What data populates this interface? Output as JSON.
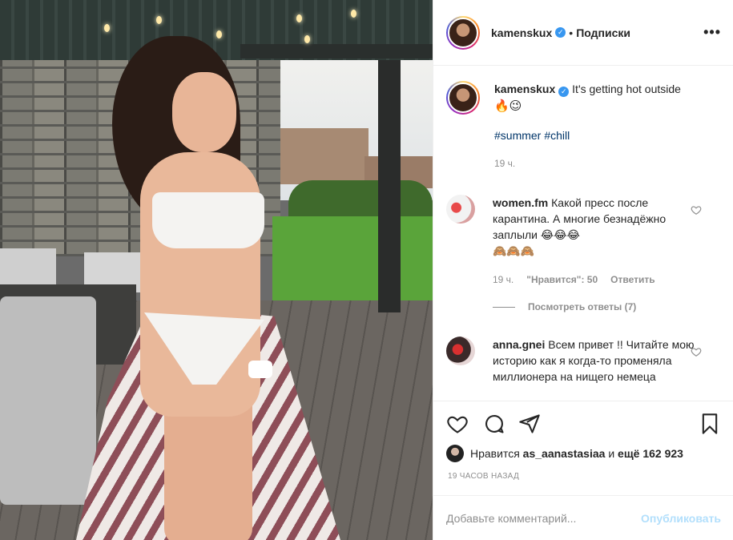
{
  "post": {
    "photo_alt": "Woman in white bikini on a wooden terrace",
    "photo_icon": "photo"
  },
  "header": {
    "username": "kamenskux",
    "separator": "•",
    "follow_label": "Подписки",
    "more_label": "•••",
    "verified_icon": "verified-badge-icon"
  },
  "caption": {
    "username": "kamenskux",
    "text": "It's getting hot outside",
    "emoji": "🔥😉",
    "tags": [
      "#summer",
      "#chill"
    ],
    "time": "19 ч."
  },
  "comments": [
    {
      "username": "women.fm",
      "text": "Какой пресс после карантина. А многие безнадёжно заплыли",
      "emoji": "😂😂😂",
      "emoji2": "🙈🙈🙈",
      "time": "19 ч.",
      "likes": "\"Нравится\": 50",
      "reply": "Ответить",
      "view_replies": "Посмотреть ответы (7)"
    },
    {
      "username": "anna.gnei",
      "text": "Всем привет !! Читайте мою историю как я когда-то променяла миллионера на нищего немеца"
    }
  ],
  "likes": {
    "prefix": "Нравится",
    "user": "as_aanastasiaa",
    "middle": "и",
    "rest": "ещё 162 923"
  },
  "timeago": "19 часов назад",
  "comment_box": {
    "placeholder": "Добавьте комментарий...",
    "publish_label": "Опубликовать"
  },
  "colors": {
    "link": "#003569",
    "verified": "#3897f0",
    "publish_disabled": "#b2dffc",
    "muted": "#8e8e8e"
  }
}
